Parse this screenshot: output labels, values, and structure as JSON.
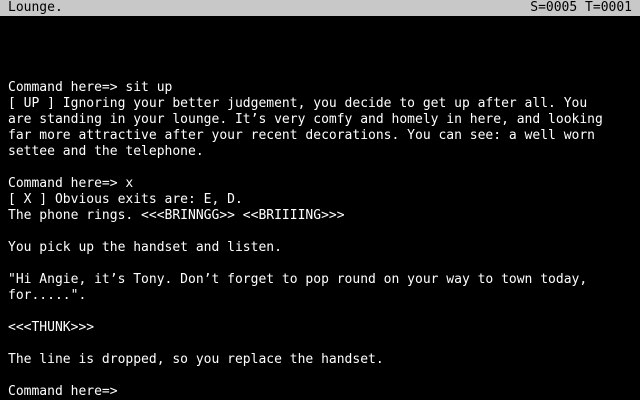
{
  "status": {
    "location": "Lounge.",
    "score_turns": "S=0005 T=0001"
  },
  "transcript": {
    "lines": [
      "",
      "",
      "",
      "",
      "Command here=> sit up",
      "[ UP ] Ignoring your better judgement, you decide to get up after all. You",
      "are standing in your lounge. It’s very comfy and homely in here, and looking",
      "far more attractive after your recent decorations. You can see: a well worn",
      "settee and the telephone.",
      "",
      "Command here=> x",
      "[ X ] Obvious exits are: E, D.",
      "The phone rings. <<<BRINNGG>> <<BRIIIING>>>",
      "",
      "You pick up the handset and listen.",
      "",
      "\"Hi Angie, it’s Tony. Don’t forget to pop round on your way to town today,",
      "for.....\".",
      "",
      "<<<THUNK>>>",
      "",
      "The line is dropped, so you replace the handset.",
      "",
      "Command here=>"
    ]
  },
  "colors": {
    "background": "#000000",
    "text": "#ffffff",
    "status_bar": "#c8c8c8",
    "status_text": "#000000"
  }
}
